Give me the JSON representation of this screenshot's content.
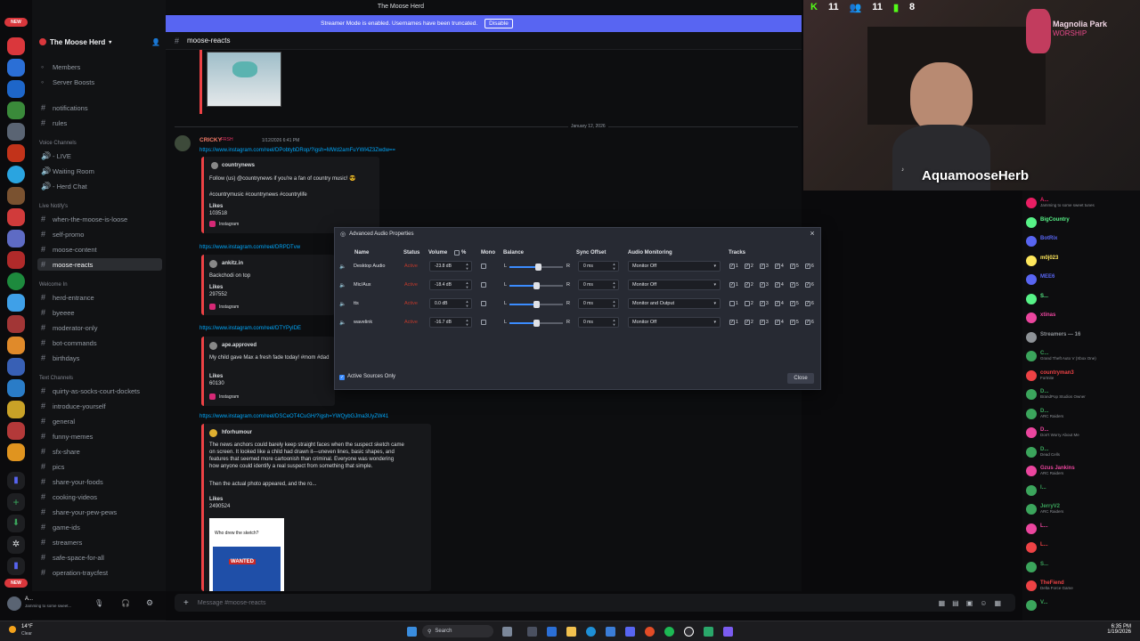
{
  "window": {
    "title": "The Moose Herd"
  },
  "streamer_bar": {
    "text": "Streamer Mode is enabled. Usernames have been truncated.",
    "button": "Disable"
  },
  "server": {
    "name": "The Moose Herd"
  },
  "sidebar": {
    "items": [
      {
        "label": "Members",
        "type": "item"
      },
      {
        "label": "Server Boosts",
        "type": "item"
      },
      {
        "label": "notifications",
        "type": "channel"
      },
      {
        "label": "rules",
        "type": "channel"
      },
      {
        "label": "Voice Channels",
        "type": "category"
      },
      {
        "label": "- LIVE",
        "type": "voice"
      },
      {
        "label": "Waiting Room",
        "type": "voice"
      },
      {
        "label": "- Herd Chat",
        "type": "voice"
      },
      {
        "label": "Live Notify's",
        "type": "category"
      },
      {
        "label": "when-the-moose-is-loose",
        "type": "channel"
      },
      {
        "label": "self-promo",
        "type": "channel"
      },
      {
        "label": "moose-content",
        "type": "channel"
      },
      {
        "label": "moose-reacts",
        "type": "channel",
        "selected": true
      },
      {
        "label": "Welcome In",
        "type": "category"
      },
      {
        "label": "herd-entrance",
        "type": "channel"
      },
      {
        "label": "byeeee",
        "type": "channel"
      },
      {
        "label": "moderator-only",
        "type": "channel"
      },
      {
        "label": "bot-commands",
        "type": "channel"
      },
      {
        "label": "birthdays",
        "type": "channel"
      },
      {
        "label": "Text Channels",
        "type": "category"
      },
      {
        "label": "quirty-as-socks-court-dockets",
        "type": "channel"
      },
      {
        "label": "introduce-yourself",
        "type": "channel"
      },
      {
        "label": "general",
        "type": "channel"
      },
      {
        "label": "funny-memes",
        "type": "channel"
      },
      {
        "label": "sfx-share",
        "type": "channel"
      },
      {
        "label": "pics",
        "type": "channel"
      },
      {
        "label": "share-your-foods",
        "type": "channel"
      },
      {
        "label": "cooking-videos",
        "type": "channel"
      },
      {
        "label": "share-your-pew-pews",
        "type": "channel"
      },
      {
        "label": "game-ids",
        "type": "channel"
      },
      {
        "label": "streamers",
        "type": "channel"
      },
      {
        "label": "safe-space-for-all",
        "type": "channel"
      },
      {
        "label": "operation-traycfest",
        "type": "channel"
      }
    ]
  },
  "channel_header": {
    "name": "moose-reacts"
  },
  "messages": {
    "date_divider": "January 12, 2026",
    "author": "CRICKY",
    "author_tag": "FRSH",
    "timestamp": "1/12/2026 6:41 PM",
    "link1": "https://www.instagram.com/reel/DPobtybDRop/?igsh=MWd2amFuYWI4Z3Zwdw==",
    "embed1_author": "countrynews",
    "embed1_text": "Follow (us) @countrynews if you're a fan of country music! 😎",
    "embed1_tags": "#countrymusic #countrynews #countrylife",
    "embed1_likes_label": "Likes",
    "embed1_likes": "103518",
    "embed_source": "Instagram",
    "link2": "https://www.instagram.com/reel/DRPDTvw",
    "embed2_author": "ankitz.in",
    "embed2_text": "Backchodi on top",
    "embed2_likes": "297552",
    "link3": "https://www.instagram.com/reel/DTYPyIDE",
    "embed3_author": "ape.approved",
    "embed3_text": "My child gave Max a fresh fade today! #mom #dad",
    "embed3_likes": "60130",
    "link4": "https://www.instagram.com/reel/DSCeOT4CuGH/?igsh=YWQybGJma3UyZW41",
    "embed4_author": "hforhumour",
    "embed4_text1": "The news anchors could barely keep straight faces when the suspect sketch came",
    "embed4_text2": "on screen. It looked like a child had drawn it—uneven lines, basic shapes, and",
    "embed4_text3": "features that seemed more cartoonish than criminal. Everyone was wondering",
    "embed4_text4": "how anyone could identify a real suspect from something that simple.",
    "embed4_text5": "Then the actual photo appeared, and the ro...",
    "embed4_likes": "2490524",
    "thumb_caption": "Who drew the sketch?",
    "thumb_word": "WANTED"
  },
  "composer": {
    "placeholder": "Message #moose-reacts"
  },
  "dialog": {
    "title": "Advanced Audio Properties",
    "close_x": "×",
    "headers": {
      "name": "Name",
      "status": "Status",
      "volume": "Volume",
      "percent": "%",
      "mono": "Mono",
      "balance": "Balance",
      "sync": "Sync Offset",
      "monitoring": "Audio Monitoring",
      "tracks": "Tracks"
    },
    "rows": [
      {
        "name": "Desktop Audio",
        "status": "Active",
        "volume": "-23.8 dB",
        "balance_l": "L",
        "balance_r": "R",
        "sync": "0 ms",
        "monitoring": "Monitor Off",
        "tracks": [
          true,
          true,
          true,
          true,
          true,
          true
        ]
      },
      {
        "name": "Mic/Aux",
        "status": "Active",
        "volume": "-18.4 dB",
        "balance_l": "L",
        "balance_r": "R",
        "sync": "0 ms",
        "monitoring": "Monitor Off",
        "tracks": [
          true,
          true,
          true,
          true,
          true,
          true
        ]
      },
      {
        "name": "tts",
        "status": "Active",
        "volume": "0.0 dB",
        "balance_l": "L",
        "balance_r": "R",
        "sync": "0 ms",
        "monitoring": "Monitor and Output",
        "tracks": [
          false,
          false,
          true,
          true,
          true,
          true
        ]
      },
      {
        "name": "wavelink",
        "status": "Active",
        "volume": "-16.7 dB",
        "balance_l": "L",
        "balance_r": "R",
        "sync": "0 ms",
        "monitoring": "Monitor Off",
        "tracks": [
          true,
          true,
          true,
          true,
          true,
          true
        ]
      }
    ],
    "track_numbers": [
      "1",
      "2",
      "3",
      "4",
      "5",
      "6"
    ],
    "active_only": "Active Sources Only",
    "close_button": "Close"
  },
  "webcam": {
    "streamer": "AquamooseHerb",
    "stat1": "11",
    "stat2": "11",
    "stat3": "8",
    "overlay_name": "Magnolia Park",
    "overlay_sub": "WORSHIP"
  },
  "chat": {
    "lines": [
      {
        "name": "A...",
        "sub": "Jamming to some sweet tunes",
        "color": "#e91e63"
      },
      {
        "name": "BigCountry",
        "sub": "",
        "color": "#57f287"
      },
      {
        "name": "BotRix",
        "sub": "",
        "color": "#5865f2"
      },
      {
        "name": "m0j023",
        "sub": "",
        "color": "#fee75c"
      },
      {
        "name": "MEE6",
        "sub": "",
        "color": "#5865f2"
      },
      {
        "name": "S...",
        "sub": "",
        "color": "#57f287"
      },
      {
        "name": "xtinas",
        "sub": "",
        "color": "#eb459e"
      },
      {
        "name": "Streamers — 16",
        "sub": "",
        "color": "#8e9297"
      },
      {
        "name": "C...",
        "sub": "Grand Theft Auto V (Xbox One)",
        "color": "#3ba55c"
      },
      {
        "name": "countryman3",
        "sub": "Fortnite",
        "color": "#ed4245"
      },
      {
        "name": "D...",
        "sub": "BrandPop Studios Owner",
        "color": "#3ba55c"
      },
      {
        "name": "D...",
        "sub": "ARC Raiders",
        "color": "#3ba55c"
      },
      {
        "name": "D...",
        "sub": "Don't Worry About Me",
        "color": "#eb459e"
      },
      {
        "name": "D...",
        "sub": "Dead Cells",
        "color": "#3ba55c"
      },
      {
        "name": "Gzus Jankins",
        "sub": "ARC Raiders",
        "color": "#eb459e"
      },
      {
        "name": "I...",
        "sub": "",
        "color": "#3ba55c"
      },
      {
        "name": "JerryV2",
        "sub": "ARC Raiders",
        "color": "#3ba55c"
      },
      {
        "name": "L...",
        "sub": "",
        "color": "#eb459e"
      },
      {
        "name": "L...",
        "sub": "",
        "color": "#ed4245"
      },
      {
        "name": "S...",
        "sub": "",
        "color": "#3ba55c"
      },
      {
        "name": "TheFiend",
        "sub": "Delta Force Game",
        "color": "#ed4245"
      },
      {
        "name": "V...",
        "sub": "",
        "color": "#3ba55c"
      }
    ]
  },
  "user": {
    "name": "A...",
    "status": "Jamming to some sweet..."
  },
  "taskbar": {
    "weather_temp": "14°F",
    "weather_desc": "Clear",
    "search": "Search",
    "time": "6:35 PM",
    "date": "1/19/2026"
  }
}
